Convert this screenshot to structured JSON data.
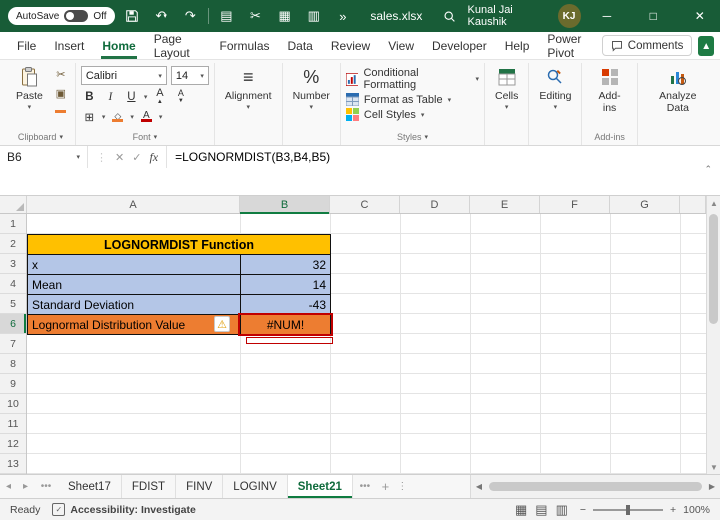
{
  "titlebar": {
    "autosave_label": "AutoSave",
    "autosave_state": "Off",
    "filename": "sales.xlsx",
    "user": {
      "name": "Kunal Jai Kaushik",
      "initials": "KJ"
    }
  },
  "menubar": {
    "items": [
      "File",
      "Insert",
      "Home",
      "Page Layout",
      "Formulas",
      "Data",
      "Review",
      "View",
      "Developer",
      "Help",
      "Power Pivot"
    ],
    "active_item": "Home",
    "comments_label": "Comments"
  },
  "ribbon": {
    "paste": "Paste",
    "clipboard_group": "Clipboard",
    "font_group": "Font",
    "font_name": "Calibri",
    "font_size": "14",
    "bold": "B",
    "italic": "I",
    "underline": "U",
    "alignment": "Alignment",
    "number": "Number",
    "conditional_formatting": "Conditional Formatting",
    "format_as_table": "Format as Table",
    "cell_styles": "Cell Styles",
    "styles_group": "Styles",
    "cells": "Cells",
    "editing": "Editing",
    "add_ins": "Add-ins",
    "add_ins_group": "Add-ins",
    "analyze_data": "Analyze Data"
  },
  "formula_bar": {
    "name_box": "B6",
    "fx": "fx",
    "formula": "=LOGNORMDIST(B3,B4,B5)"
  },
  "sheet": {
    "columns": [
      "A",
      "B",
      "C",
      "D",
      "E",
      "F",
      "G"
    ],
    "rows": [
      "1",
      "2",
      "3",
      "4",
      "5",
      "6",
      "7",
      "8",
      "9",
      "10",
      "11",
      "12",
      "13"
    ],
    "selected_cell": "B6",
    "title_cell": "LOGNORMDIST Function",
    "table": [
      {
        "label": "x",
        "value": "32"
      },
      {
        "label": "Mean",
        "value": "14"
      },
      {
        "label": "Standard Deviation",
        "value": "-43"
      },
      {
        "label": "Lognormal Distribution Value",
        "value": "#NUM!"
      }
    ],
    "colors": {
      "title_bg": "#FFC000",
      "input_bg": "#B4C6E7",
      "result_bg": "#ED7D31",
      "error_border": "#C00000"
    }
  },
  "sheet_tabs": {
    "tabs": [
      "Sheet17",
      "FDIST",
      "FINV",
      "LOGINV",
      "Sheet21"
    ],
    "active_tab": "Sheet21"
  },
  "status_bar": {
    "mode": "Ready",
    "accessibility": "Accessibility: Investigate",
    "zoom": "100%"
  }
}
